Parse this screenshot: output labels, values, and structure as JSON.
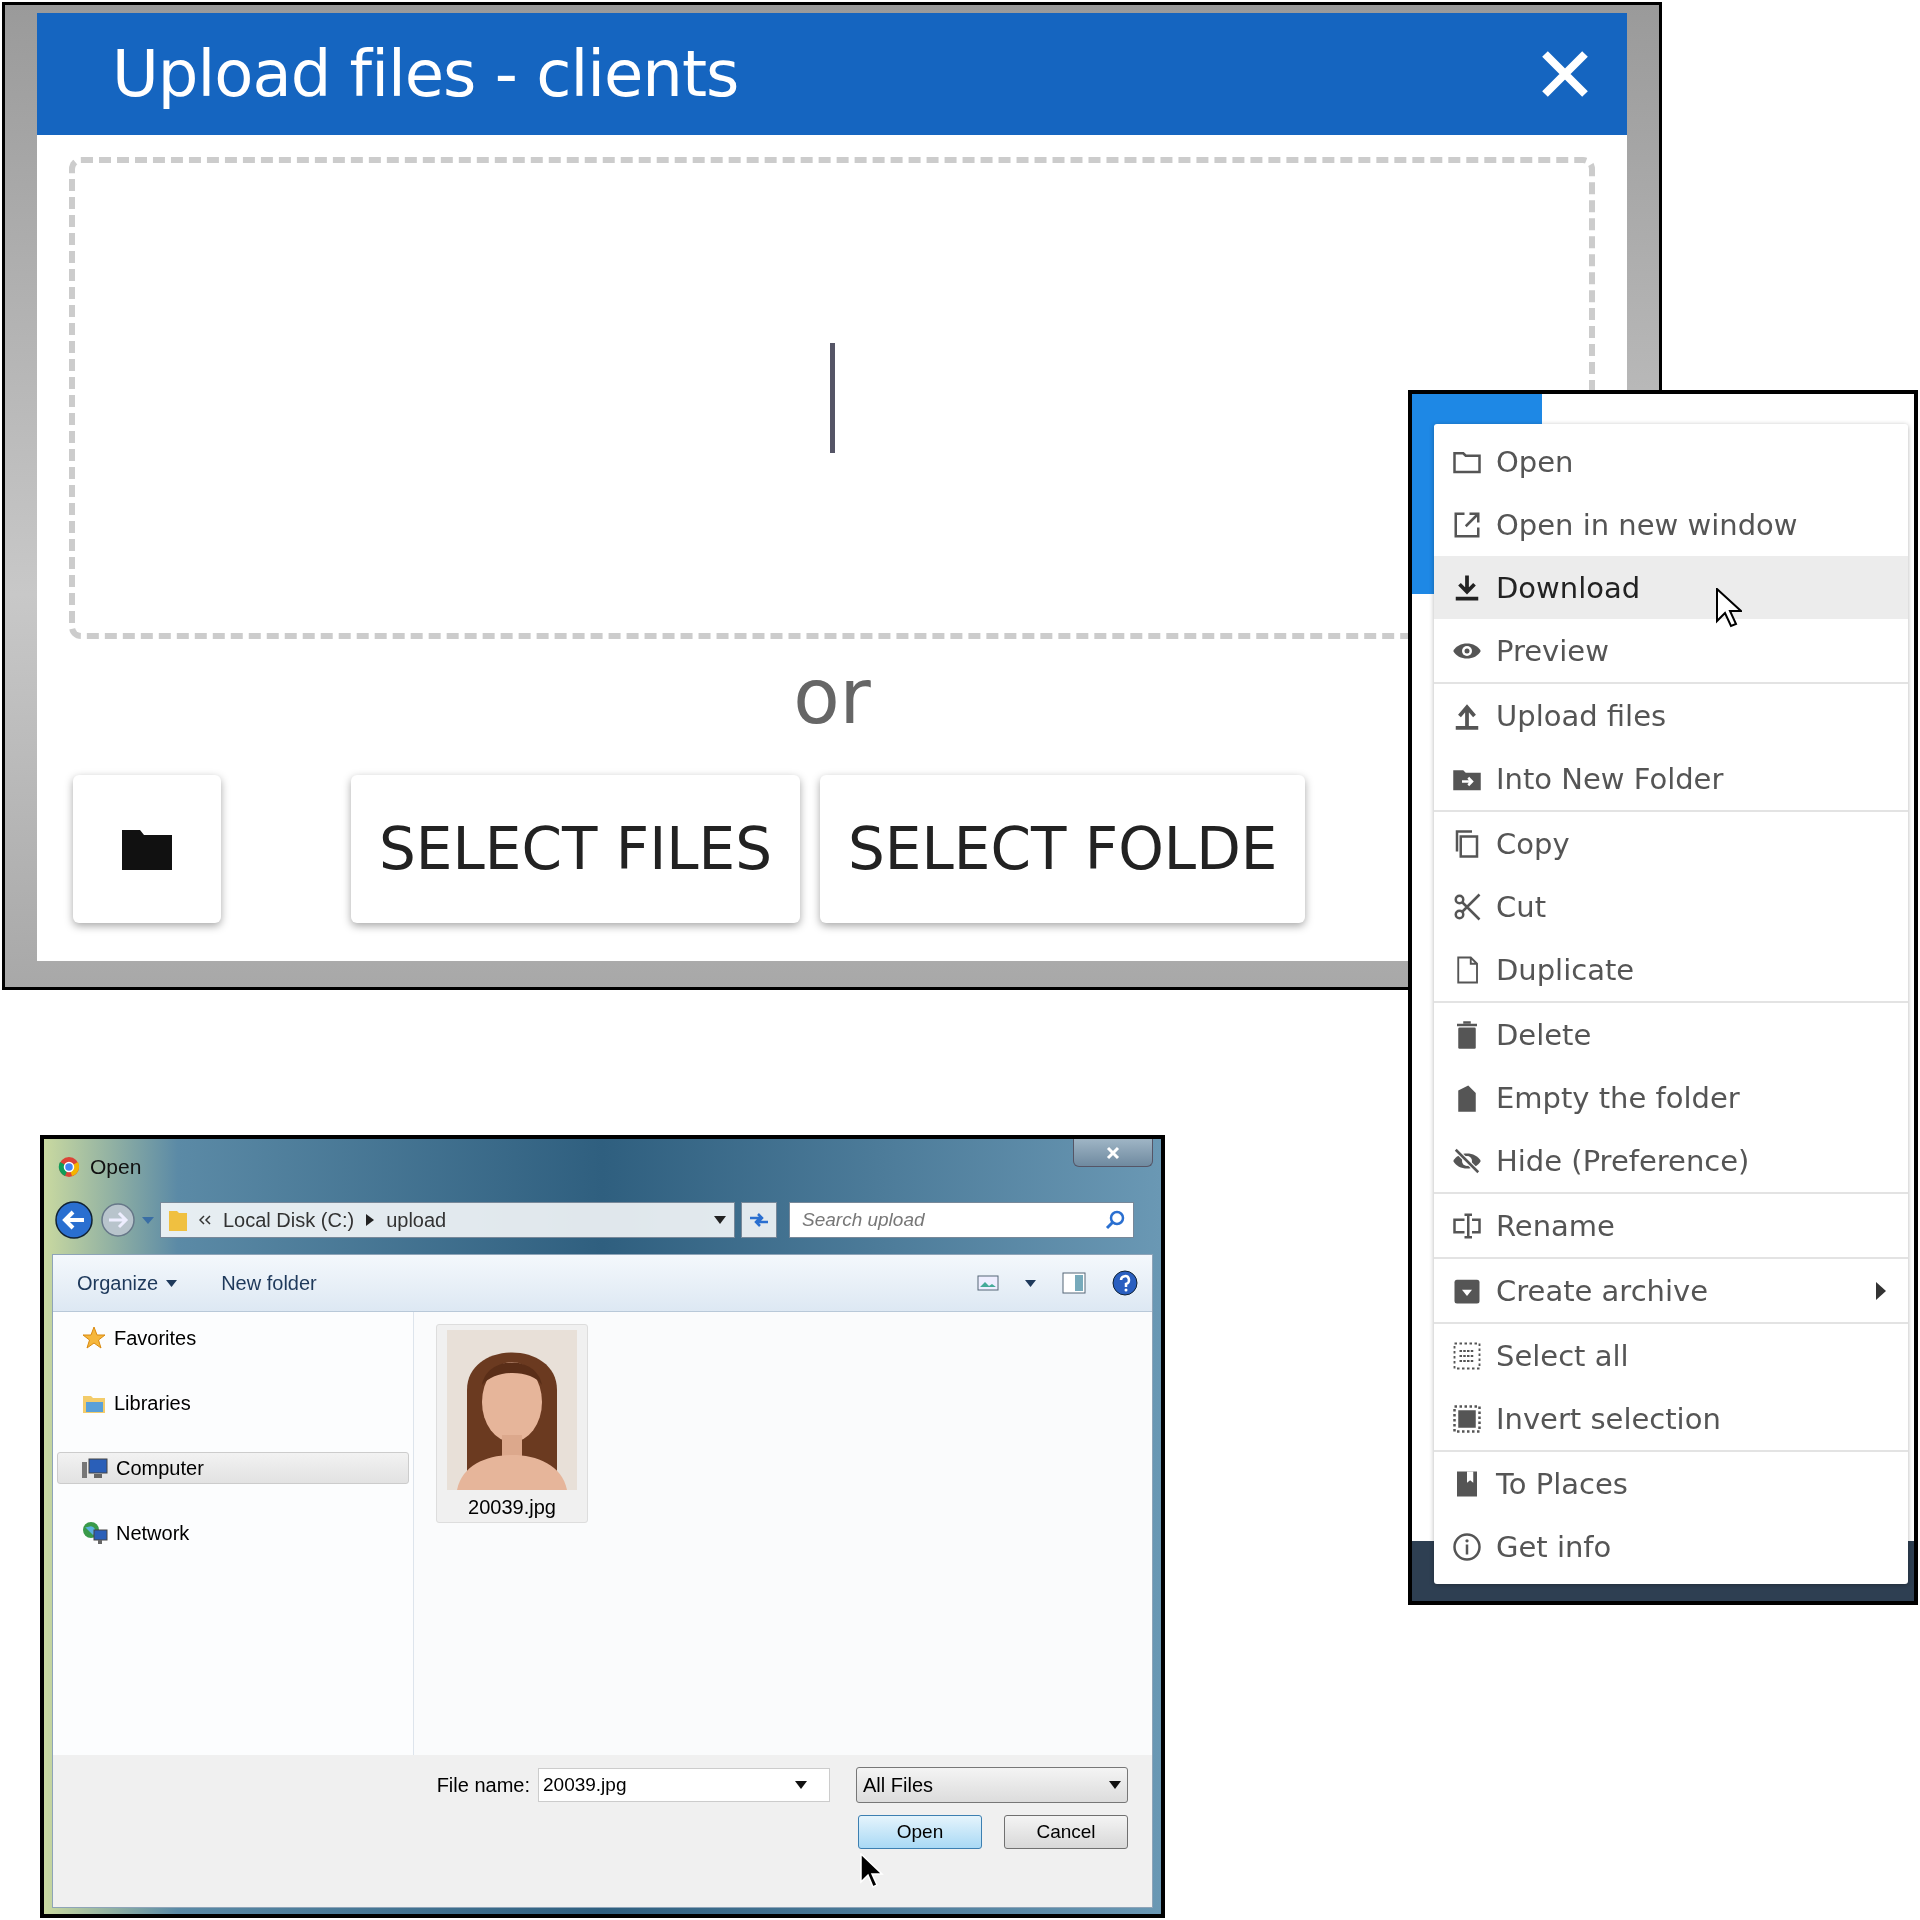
{
  "upload_dialog": {
    "title": "Upload files - clients",
    "or_text": "or",
    "buttons": [
      "SELECT FILES",
      "SELECT FOLDE"
    ]
  },
  "context_menu": {
    "groups": [
      [
        {
          "label": "Open",
          "hovered": false,
          "has_submenu": false
        },
        {
          "label": "Open in new window",
          "hovered": false,
          "has_submenu": false
        },
        {
          "label": "Download",
          "hovered": true,
          "has_submenu": false
        },
        {
          "label": "Preview",
          "hovered": false,
          "has_submenu": false
        }
      ],
      [
        {
          "label": "Upload files",
          "hovered": false,
          "has_submenu": false
        },
        {
          "label": "Into New Folder",
          "hovered": false,
          "has_submenu": false
        }
      ],
      [
        {
          "label": "Copy",
          "hovered": false,
          "has_submenu": false
        },
        {
          "label": "Cut",
          "hovered": false,
          "has_submenu": false
        },
        {
          "label": "Duplicate",
          "hovered": false,
          "has_submenu": false
        }
      ],
      [
        {
          "label": "Delete",
          "hovered": false,
          "has_submenu": false
        },
        {
          "label": "Empty the folder",
          "hovered": false,
          "has_submenu": false
        },
        {
          "label": "Hide (Preference)",
          "hovered": false,
          "has_submenu": false
        }
      ],
      [
        {
          "label": "Rename",
          "hovered": false,
          "has_submenu": false
        }
      ],
      [
        {
          "label": "Create archive",
          "hovered": false,
          "has_submenu": true
        }
      ],
      [
        {
          "label": "Select all",
          "hovered": false,
          "has_submenu": false
        },
        {
          "label": "Invert selection",
          "hovered": false,
          "has_submenu": false
        }
      ],
      [
        {
          "label": "To Places",
          "hovered": false,
          "has_submenu": false
        },
        {
          "label": "Get info",
          "hovered": false,
          "has_submenu": false
        }
      ]
    ]
  },
  "open_dialog": {
    "title": "Open",
    "path": [
      "Local Disk (C:)",
      "upload"
    ],
    "search": {
      "placeholder": "Search upload"
    },
    "toolbar": [
      "Organize",
      "New folder"
    ],
    "nav": [
      {
        "label": "Favorites",
        "selected": false
      },
      {
        "label": "Libraries",
        "selected": false
      },
      {
        "label": "Computer",
        "selected": true
      },
      {
        "label": "Network",
        "selected": false
      }
    ],
    "files": [
      {
        "name": "20039.jpg",
        "kind": "picture"
      }
    ],
    "file_name": {
      "label": "File name:",
      "value": "20039.jpg"
    },
    "file_type": "All Files",
    "buttons": [
      {
        "label": "Open",
        "default": true
      },
      {
        "label": "Cancel",
        "default": false
      }
    ]
  }
}
